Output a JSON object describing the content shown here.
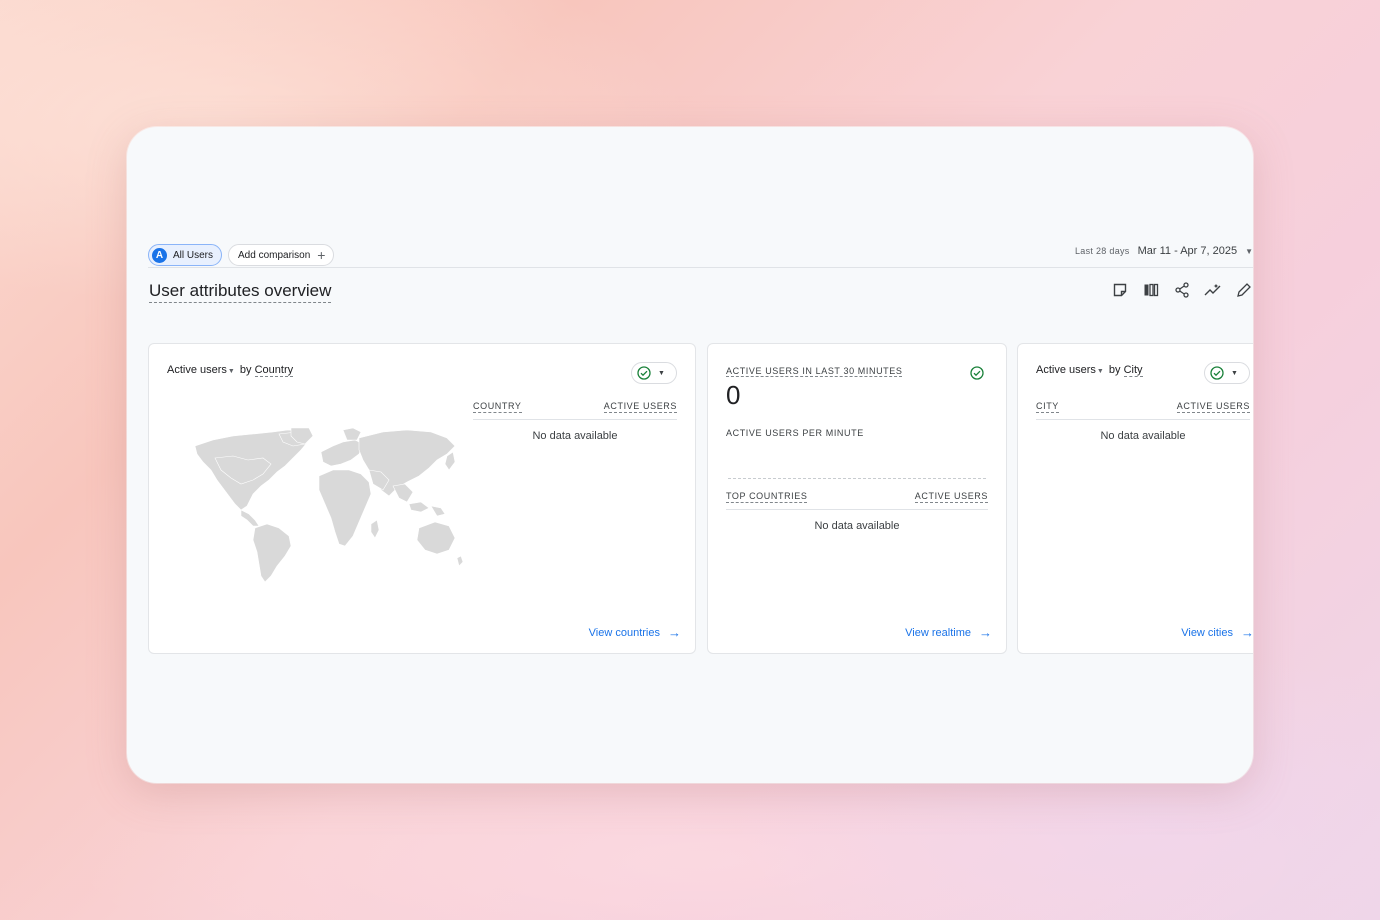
{
  "toolbar": {
    "segment_badge": "A",
    "segment_label": "All Users",
    "add_comparison_label": "Add comparison",
    "date_range_label": "Last 28 days",
    "date_range_value": "Mar 11 - Apr 7, 2025"
  },
  "page": {
    "title": "User attributes overview"
  },
  "actions": {
    "icons": [
      "note-icon",
      "compare-icon",
      "share-icon",
      "insights-icon",
      "edit-icon"
    ]
  },
  "cards": {
    "country": {
      "metric": "Active users",
      "by": "by",
      "dimension": "Country",
      "col_dimension": "COUNTRY",
      "col_metric": "ACTIVE USERS",
      "no_data": "No data available",
      "link": "View countries"
    },
    "realtime": {
      "title": "ACTIVE USERS IN LAST 30 MINUTES",
      "value": "0",
      "per_minute_label": "ACTIVE USERS PER MINUTE",
      "col_dimension": "TOP COUNTRIES",
      "col_metric": "ACTIVE USERS",
      "no_data": "No data available",
      "link": "View realtime"
    },
    "city": {
      "metric": "Active users",
      "by": "by",
      "dimension": "City",
      "col_dimension": "CITY",
      "col_metric": "ACTIVE USERS",
      "no_data": "No data available",
      "link": "View cities"
    }
  },
  "colors": {
    "accent": "#1a73e8",
    "check": "#188038",
    "map_fill": "#d9d9d9"
  }
}
